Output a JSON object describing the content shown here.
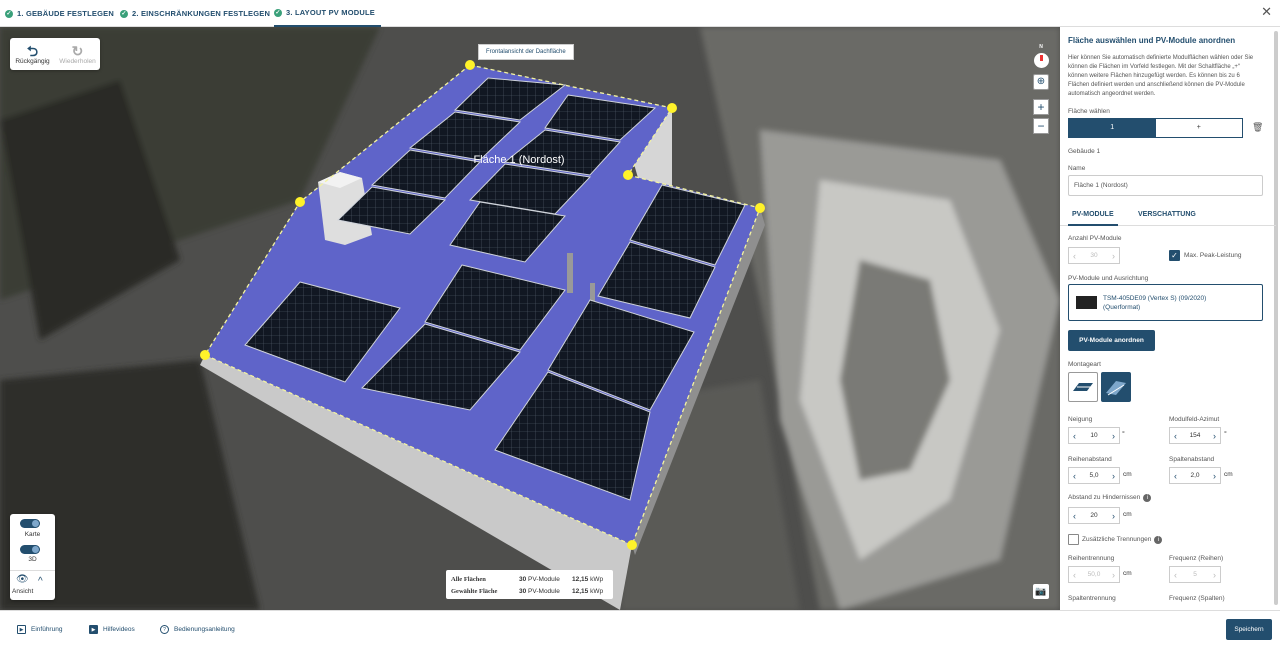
{
  "steps": [
    {
      "label": "1. GEBÄUDE FESTLEGEN"
    },
    {
      "label": "2. EINSCHRÄNKUNGEN FESTLEGEN"
    },
    {
      "label": "3. LAYOUT PV MODULE"
    }
  ],
  "close_icon": "✕",
  "toolbar": {
    "undo_label": "Rückgängig",
    "redo_label": "Wiederholen"
  },
  "map": {
    "tooltip": "Frontalansicht der Dachfläche",
    "roof_label": "Fläche 1 (Nordost)",
    "compass": "N",
    "zoom_in": "+",
    "zoom_out": "−"
  },
  "view": {
    "karte": "Karte",
    "d3": "3D",
    "ansicht": "Ansicht"
  },
  "summary": {
    "rows": [
      {
        "label": "Alle Flächen",
        "count": "30",
        "unit": "PV-Module",
        "kwp": "12,15",
        "kwp_unit": "kWp"
      },
      {
        "label": "Gewählte Fläche",
        "count": "30",
        "unit": "PV-Module",
        "kwp": "12,15",
        "kwp_unit": "kWp"
      }
    ]
  },
  "panel": {
    "title": "Fläche auswählen und PV-Module anordnen",
    "desc": "Hier können Sie automatisch definierte Modulflächen wählen oder Sie können die Flächen im Vorfeld festlegen. Mit der Schaltfläche „+“ können weitere Flächen hinzugefügt werden. Es können bis zu 6 Flächen definiert werden und anschließend können die PV-Module automatisch angeordnet werden.",
    "flaeche_label": "Fläche wählen",
    "flaeche_1": "1",
    "flaeche_add": "+",
    "gebaeude": "Gebäude 1",
    "name_label": "Name",
    "name_value": "Fläche 1 (Nordost)",
    "tab_pv": "PV-MODULE",
    "tab_shade": "VERSCHATTUNG",
    "anzahl_label": "Anzahl PV-Module",
    "anzahl_value": "30",
    "maxpeak_label": "Max. Peak-Leistung",
    "modules_label": "PV-Module und Ausrichtung",
    "module_name": "TSM-405DE09 (Vertex S) (09/2020)",
    "module_orient": "(Querformat)",
    "arrange_btn": "PV-Module anordnen",
    "montage_label": "Montageart",
    "neigung_label": "Neigung",
    "neigung_value": "10",
    "neigung_unit": "°",
    "azimut_label": "Modulfeld-Azimut",
    "azimut_value": "154",
    "azimut_unit": "°",
    "reihen_label": "Reihenabstand",
    "reihen_value": "5,0",
    "reihen_unit": "cm",
    "spalten_label": "Spaltenabstand",
    "spalten_value": "2,0",
    "spalten_unit": "cm",
    "hind_label": "Abstand zu Hindernissen",
    "hind_value": "20",
    "hind_unit": "cm",
    "zus_label": "Zusätzliche Trennungen",
    "rtrenn_label": "Reihentrennung",
    "rtrenn_value": "50,0",
    "rtrenn_unit": "cm",
    "freqr_label": "Frequenz (Reihen)",
    "freqr_value": "5",
    "strenn_label": "Spaltentrennung",
    "freqs_label": "Frequenz (Spalten)"
  },
  "footer": {
    "intro": "Einführung",
    "videos": "Hilfevideos",
    "manual": "Bedienungsanleitung",
    "save": "Speichern"
  }
}
